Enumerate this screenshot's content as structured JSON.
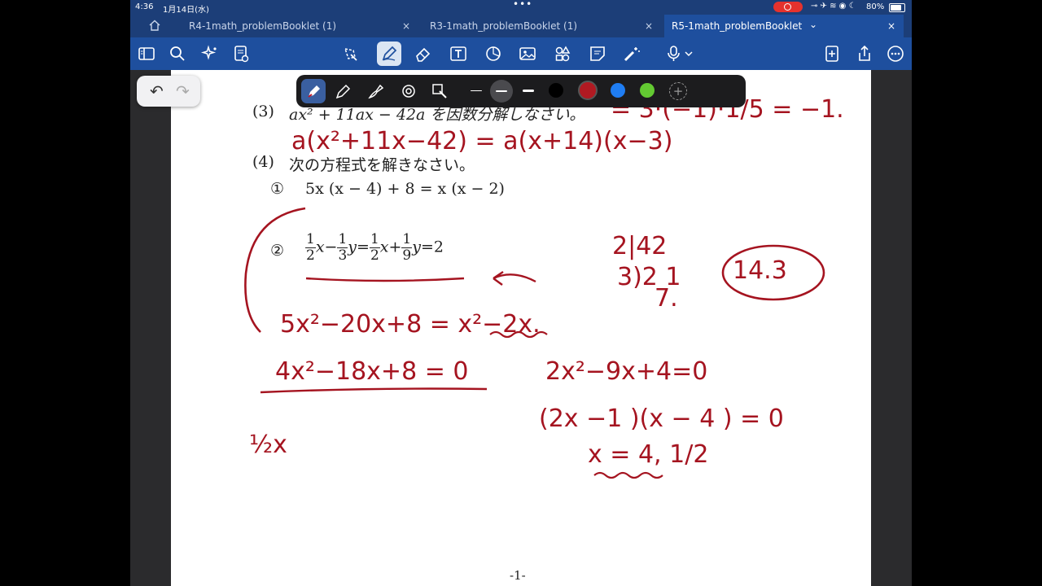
{
  "status_bar": {
    "time": "4:36",
    "date": "1月14日(水)",
    "dots": "•••",
    "system_icons": "⊸ ✈ ≋ ◉ ☾",
    "battery": "80%"
  },
  "tabs": [
    {
      "label": "R4-1math_problemBooklet (1)",
      "close": "×"
    },
    {
      "label": "R3-1math_problemBooklet (1)",
      "close": "×"
    },
    {
      "label": "R5-1math_problemBooklet",
      "chevron": "⌄",
      "close": "×"
    }
  ],
  "toolbar_icons": [
    "sidebar-icon",
    "search-icon",
    "ai-sparkle-icon",
    "document-export-icon",
    "lasso-icon",
    "pen-icon",
    "eraser-icon",
    "text-box-icon",
    "shapes-icon",
    "image-icon",
    "elements-icon",
    "sticky-note-icon",
    "laser-pointer-icon",
    "microphone-icon",
    "add-page-icon",
    "share-icon",
    "more-icon"
  ],
  "undo": {
    "undo_glyph": "↶",
    "redo_glyph": "↷"
  },
  "palette": {
    "colors": [
      "#000000",
      "#b01a22",
      "#1f7df2",
      "#63c932"
    ],
    "selected_color": "#b01a22",
    "add_glyph": "+"
  },
  "document": {
    "q3_number": "(3)",
    "q3_text": "ax² + 11ax − 42a を因数分解しなさい。",
    "q4_number": "(4)",
    "q4_text": "次の方程式を解きなさい。",
    "q4_1_marker": "①",
    "q4_1_equation": "5x (x − 4) + 8 = x (x − 2)",
    "q4_2_marker": "②",
    "page_number": "-1-"
  },
  "handwriting": {
    "top_right": "= 3·(−1)·1/5 = −1.",
    "factor_line": "a(x²+11x−42) = a(x+14)(x−3)",
    "division_top": "2|42",
    "division_mid": "3)2 1",
    "division_bottom": "7.",
    "circled": "14.3",
    "expand_line": "5x²−20x+8 = x²−2x.",
    "simplified": "4x²−18x+8 = 0",
    "halved": "2x²−9x+4=0",
    "factored": "(2x −1 )(x − 4 ) = 0",
    "solution": "x = 4, 1/2",
    "note": "½x"
  }
}
